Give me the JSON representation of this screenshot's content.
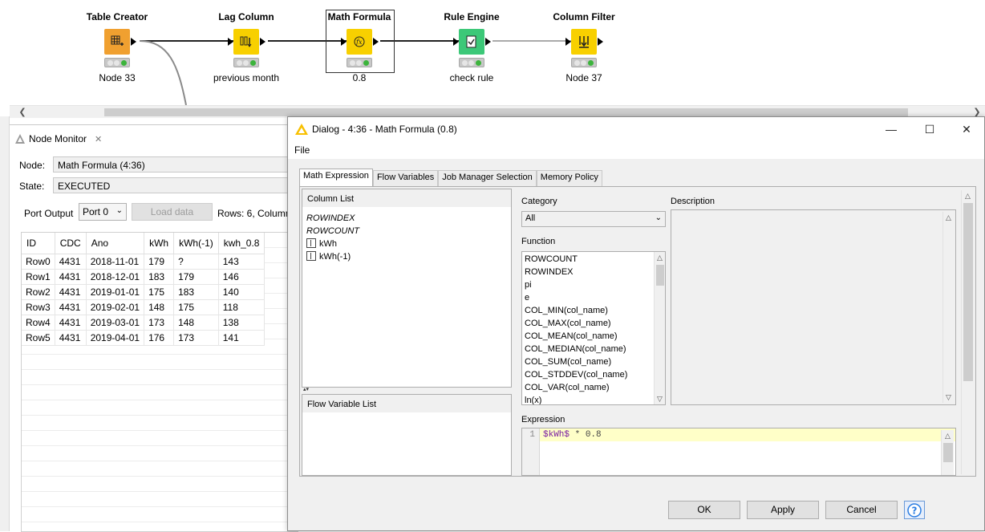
{
  "workflow": {
    "nodes": [
      {
        "title": "Table Creator",
        "label": "Node 33",
        "color": "#f0a030",
        "icon": "table-creator-icon"
      },
      {
        "title": "Lag Column",
        "label": "previous month",
        "color": "#f8d000",
        "icon": "lag-column-icon"
      },
      {
        "title": "Math Formula",
        "label": "0.8",
        "color": "#f8d000",
        "icon": "math-formula-icon"
      },
      {
        "title": "Rule Engine",
        "label": "check rule",
        "color": "#3cc878",
        "icon": "rule-engine-icon"
      },
      {
        "title": "Column Filter",
        "label": "Node 37",
        "color": "#f8d000",
        "icon": "column-filter-icon"
      }
    ]
  },
  "monitor": {
    "tab_label": "Node Monitor",
    "node_label": "Node:",
    "node_value": "Math Formula  (4:36)",
    "state_label": "State:",
    "state_value": "EXECUTED",
    "port_output_label": "Port Output",
    "port_select": "Port 0",
    "load_data": "Load data",
    "rows_info": "Rows: 6, Column",
    "table": {
      "headers": [
        "ID",
        "CDC",
        "Ano",
        "kWh",
        "kWh(-1)",
        "kwh_0.8"
      ],
      "rows": [
        [
          "Row0",
          "4431",
          "2018-11-01",
          "179",
          "?",
          "143"
        ],
        [
          "Row1",
          "4431",
          "2018-12-01",
          "183",
          "179",
          "146"
        ],
        [
          "Row2",
          "4431",
          "2019-01-01",
          "175",
          "183",
          "140"
        ],
        [
          "Row3",
          "4431",
          "2019-02-01",
          "148",
          "175",
          "118"
        ],
        [
          "Row4",
          "4431",
          "2019-03-01",
          "173",
          "148",
          "138"
        ],
        [
          "Row5",
          "4431",
          "2019-04-01",
          "176",
          "173",
          "141"
        ]
      ]
    }
  },
  "dialog": {
    "title": "Dialog - 4:36 - Math Formula (0.8)",
    "menu_file": "File",
    "tabs": [
      "Math Expression",
      "Flow Variables",
      "Job Manager Selection",
      "Memory Policy"
    ],
    "column_list_header": "Column List",
    "column_list": [
      {
        "name": "ROWINDEX",
        "italic": true,
        "icon": false
      },
      {
        "name": "ROWCOUNT",
        "italic": true,
        "icon": false
      },
      {
        "name": "kWh",
        "italic": false,
        "icon": true
      },
      {
        "name": "kWh(-1)",
        "italic": false,
        "icon": true
      }
    ],
    "flow_variable_header": "Flow Variable List",
    "category_label": "Category",
    "category_value": "All",
    "function_label": "Function",
    "functions": [
      "ROWCOUNT",
      "ROWINDEX",
      "pi",
      "e",
      "COL_MIN(col_name)",
      "COL_MAX(col_name)",
      "COL_MEAN(col_name)",
      "COL_MEDIAN(col_name)",
      "COL_SUM(col_name)",
      "COL_STDDEV(col_name)",
      "COL_VAR(col_name)",
      "ln(x)"
    ],
    "description_label": "Description",
    "expression_label": "Expression",
    "expression_line_number": "1",
    "expression_column": "$kWh$",
    "expression_rest": " * 0.8",
    "buttons": {
      "ok": "OK",
      "apply": "Apply",
      "cancel": "Cancel"
    }
  }
}
